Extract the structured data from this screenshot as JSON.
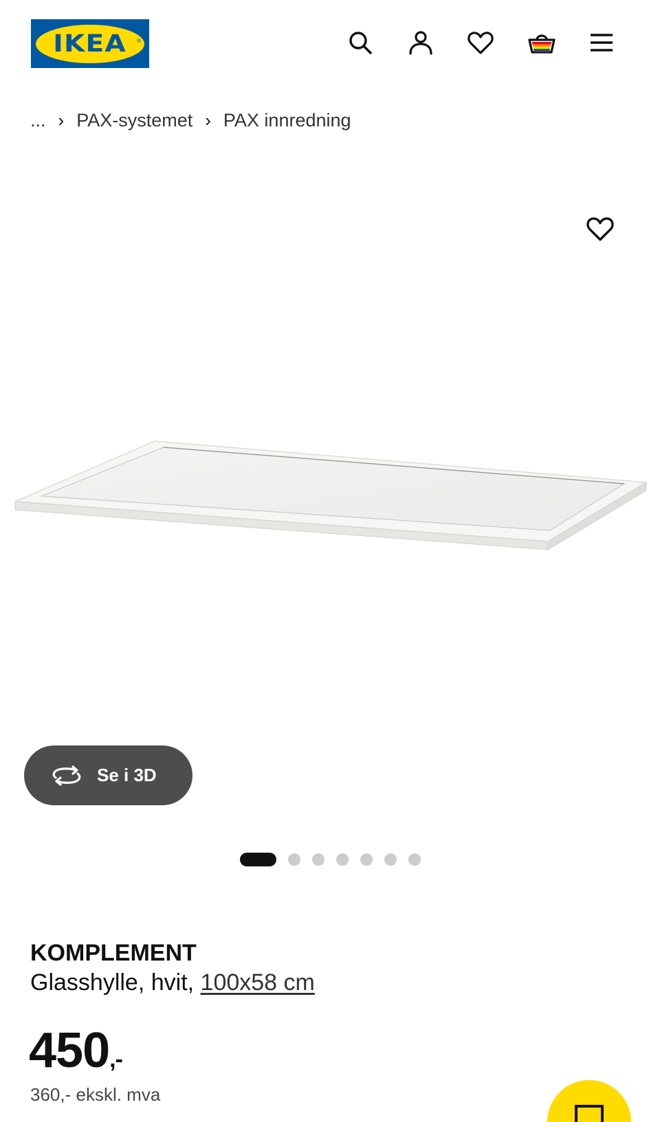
{
  "header": {
    "logo_text": "IKEA",
    "logo_reg": "®",
    "icons": [
      "search-icon",
      "user-icon",
      "heart-icon",
      "basket-icon",
      "menu-icon"
    ],
    "brand_colors": {
      "blue": "#0058a3",
      "yellow": "#ffdb00"
    }
  },
  "breadcrumb": {
    "ellipsis": "...",
    "items": [
      "PAX-systemet",
      "PAX innredning"
    ]
  },
  "gallery": {
    "view_3d_label": "Se i 3D",
    "dot_count": 7,
    "active_index": 0
  },
  "product": {
    "brand": "KOMPLEMENT",
    "description": "Glasshylle, hvit,",
    "size": "100x58 cm",
    "price": "450",
    "price_suffix": ",-",
    "price_excl_vat": "360,- ekskl. mva"
  }
}
